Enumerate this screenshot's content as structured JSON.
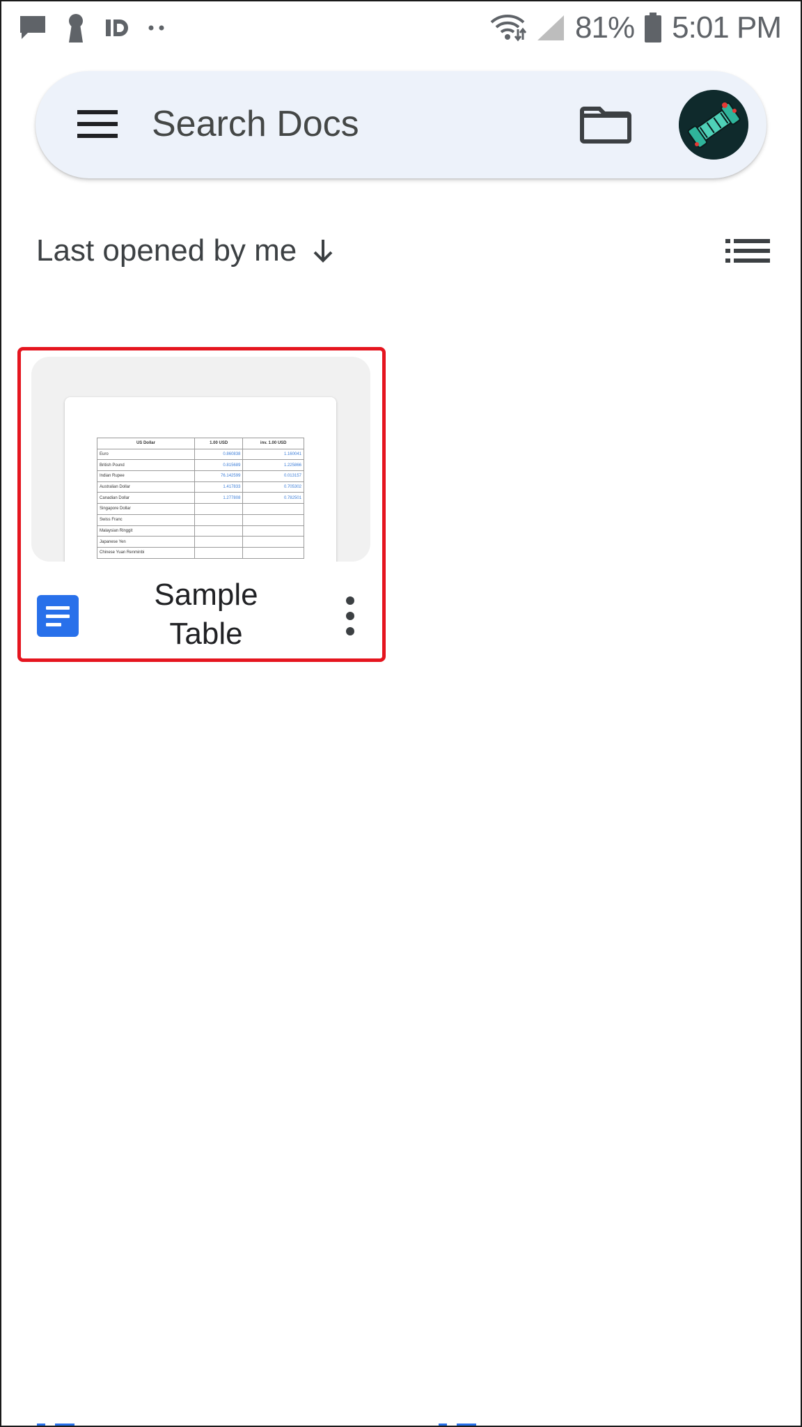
{
  "status_bar": {
    "battery": "81%",
    "time": "5:01 PM",
    "left_icons": [
      "message-icon",
      "keyhole-icon",
      "id-icon",
      "more-dots-icon"
    ],
    "right_icons": [
      "wifi-icon",
      "signal-icon",
      "battery-icon"
    ]
  },
  "search": {
    "placeholder": "Search Docs",
    "menu_icon": "hamburger-menu-icon",
    "folder_icon": "folder-icon",
    "avatar_icon": "account-avatar"
  },
  "sort": {
    "label": "Last opened by me",
    "direction_icon": "arrow-down-icon",
    "view_toggle_icon": "list-view-icon"
  },
  "documents": [
    {
      "title": "Sample Table",
      "title_lines": [
        "Sample",
        "Table"
      ],
      "icon": "docs-file-icon",
      "menu_icon": "more-vert-icon",
      "highlight_color": "#e5151f",
      "thumbnail_table": {
        "headers": [
          "US Dollar",
          "1.00 USD",
          "inv. 1.00 USD"
        ],
        "rows": [
          [
            "Euro",
            "0.860838",
            "1.160041"
          ],
          [
            "British Pound",
            "0.815689",
            "1.225866"
          ],
          [
            "Indian Rupee",
            "76.142599",
            "0.013157"
          ],
          [
            "Australian Dollar",
            "1.417833",
            "0.705302"
          ],
          [
            "Canadian Dollar",
            "1.277808",
            "0.782501"
          ],
          [
            "Singapore Dollar",
            "",
            ""
          ],
          [
            "Swiss Franc",
            "",
            ""
          ],
          [
            "Malaysian Ringgit",
            "",
            ""
          ],
          [
            "Japanese Yen",
            "",
            ""
          ],
          [
            "Chinese Yuan Renminbi",
            "",
            ""
          ]
        ]
      }
    }
  ],
  "colors": {
    "search_bg": "#edf2fa",
    "docs_blue": "#2870ea",
    "text_primary": "#202124",
    "text_secondary": "#5f6368"
  }
}
